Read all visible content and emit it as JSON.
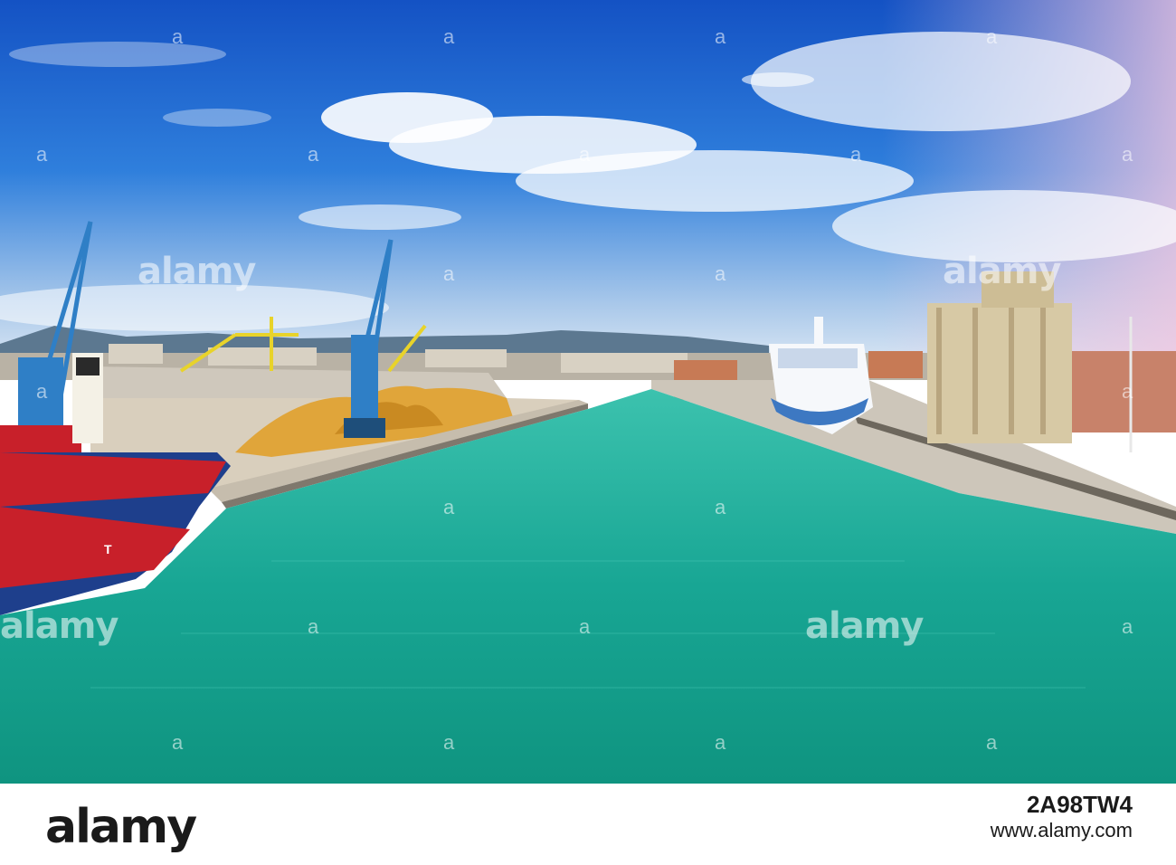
{
  "watermark": {
    "text": "alamy",
    "mark": "a"
  },
  "footer": {
    "brand": "alamy",
    "image_id": "2A98TW4",
    "url": "www.alamy.com"
  },
  "ship": {
    "hull_label": "T"
  },
  "colors": {
    "sky_top": "#1656c9",
    "sea": "#1aa897",
    "hull_red": "#c8202a",
    "hull_blue": "#1e3f8c"
  }
}
